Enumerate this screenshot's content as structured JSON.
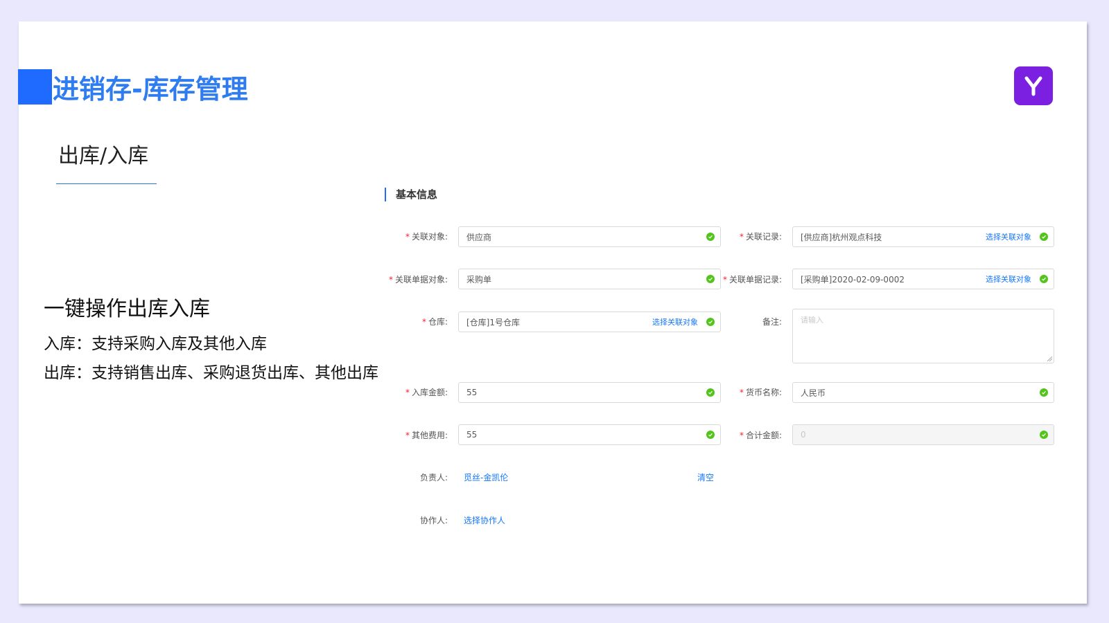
{
  "slide": {
    "title": "进销存-库存管理",
    "subtitle": "出库/入库",
    "feature": {
      "heading": "一键操作出库入库",
      "lines": [
        "入库：支持采购入库及其他入库",
        "出库：支持销售出库、采购退货出库、其他出库"
      ]
    }
  },
  "form": {
    "section_title": "基本信息",
    "required_mark": "*",
    "fields": {
      "related_object": {
        "label": "关联对象:",
        "value": "供应商"
      },
      "related_record": {
        "label": "关联记录:",
        "value": "[供应商]杭州观点科技",
        "link": "选择关联对象"
      },
      "related_doc_object": {
        "label": "关联单据对象:",
        "value": "采购单"
      },
      "related_doc_record": {
        "label": "关联单据记录:",
        "value": "[采购单]2020-02-09-0002",
        "link": "选择关联对象"
      },
      "warehouse": {
        "label": "仓库:",
        "value": "[仓库]1号仓库",
        "link": "选择关联对象"
      },
      "remark": {
        "label": "备注:",
        "placeholder": "请输入"
      },
      "in_amount": {
        "label": "入库金额:",
        "value": "55"
      },
      "currency": {
        "label": "货币名称:",
        "value": "人民币"
      },
      "other_fee": {
        "label": "其他费用:",
        "value": "55"
      },
      "total_amount": {
        "label": "合计金额:",
        "value": "0"
      },
      "owner": {
        "label": "负责人:",
        "value": "觅丝-金凯伦",
        "clear": "清空"
      },
      "collaborator": {
        "label": "协作人:",
        "link": "选择协作人"
      }
    }
  },
  "colors": {
    "accent": "#1f6bff",
    "title": "#2f7cf0",
    "logo": "#7b1fe0",
    "valid": "#52c41a",
    "required": "#f5222d",
    "link": "#1677ff"
  },
  "icons": {
    "logo": "y-logo-icon",
    "valid": "check-circle-icon"
  }
}
